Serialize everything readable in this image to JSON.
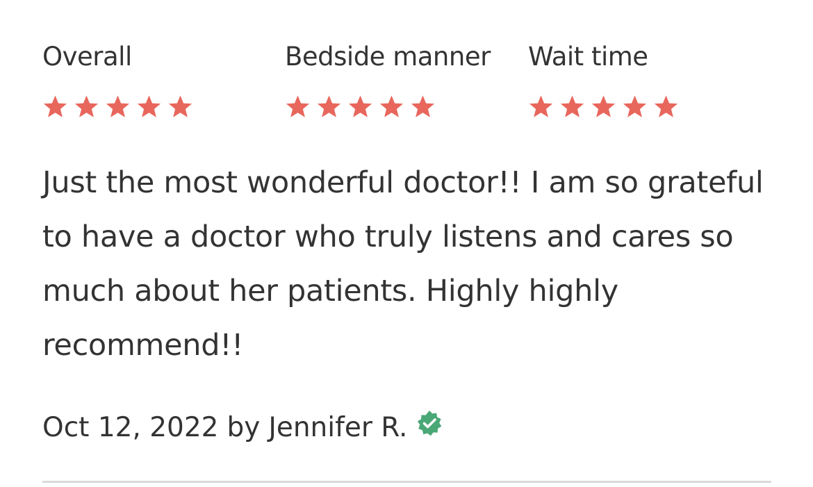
{
  "ratings": [
    {
      "label": "Overall",
      "stars": 5,
      "max": 5
    },
    {
      "label": "Bedside manner",
      "stars": 5,
      "max": 5
    },
    {
      "label": "Wait time",
      "stars": 5,
      "max": 5
    }
  ],
  "review": {
    "text": "Just the most wonderful doctor!! I am so grateful to have a doctor who truly listens and cares so much about her patients. Highly highly recommend!!",
    "date": "Oct 12, 2022",
    "by": "by",
    "author": "Jennifer R.",
    "verified_icon": "verified-badge-icon"
  },
  "colors": {
    "star": "#e8675d",
    "verified": "#4aa876",
    "text": "#333333",
    "divider": "#d9d9d9"
  }
}
